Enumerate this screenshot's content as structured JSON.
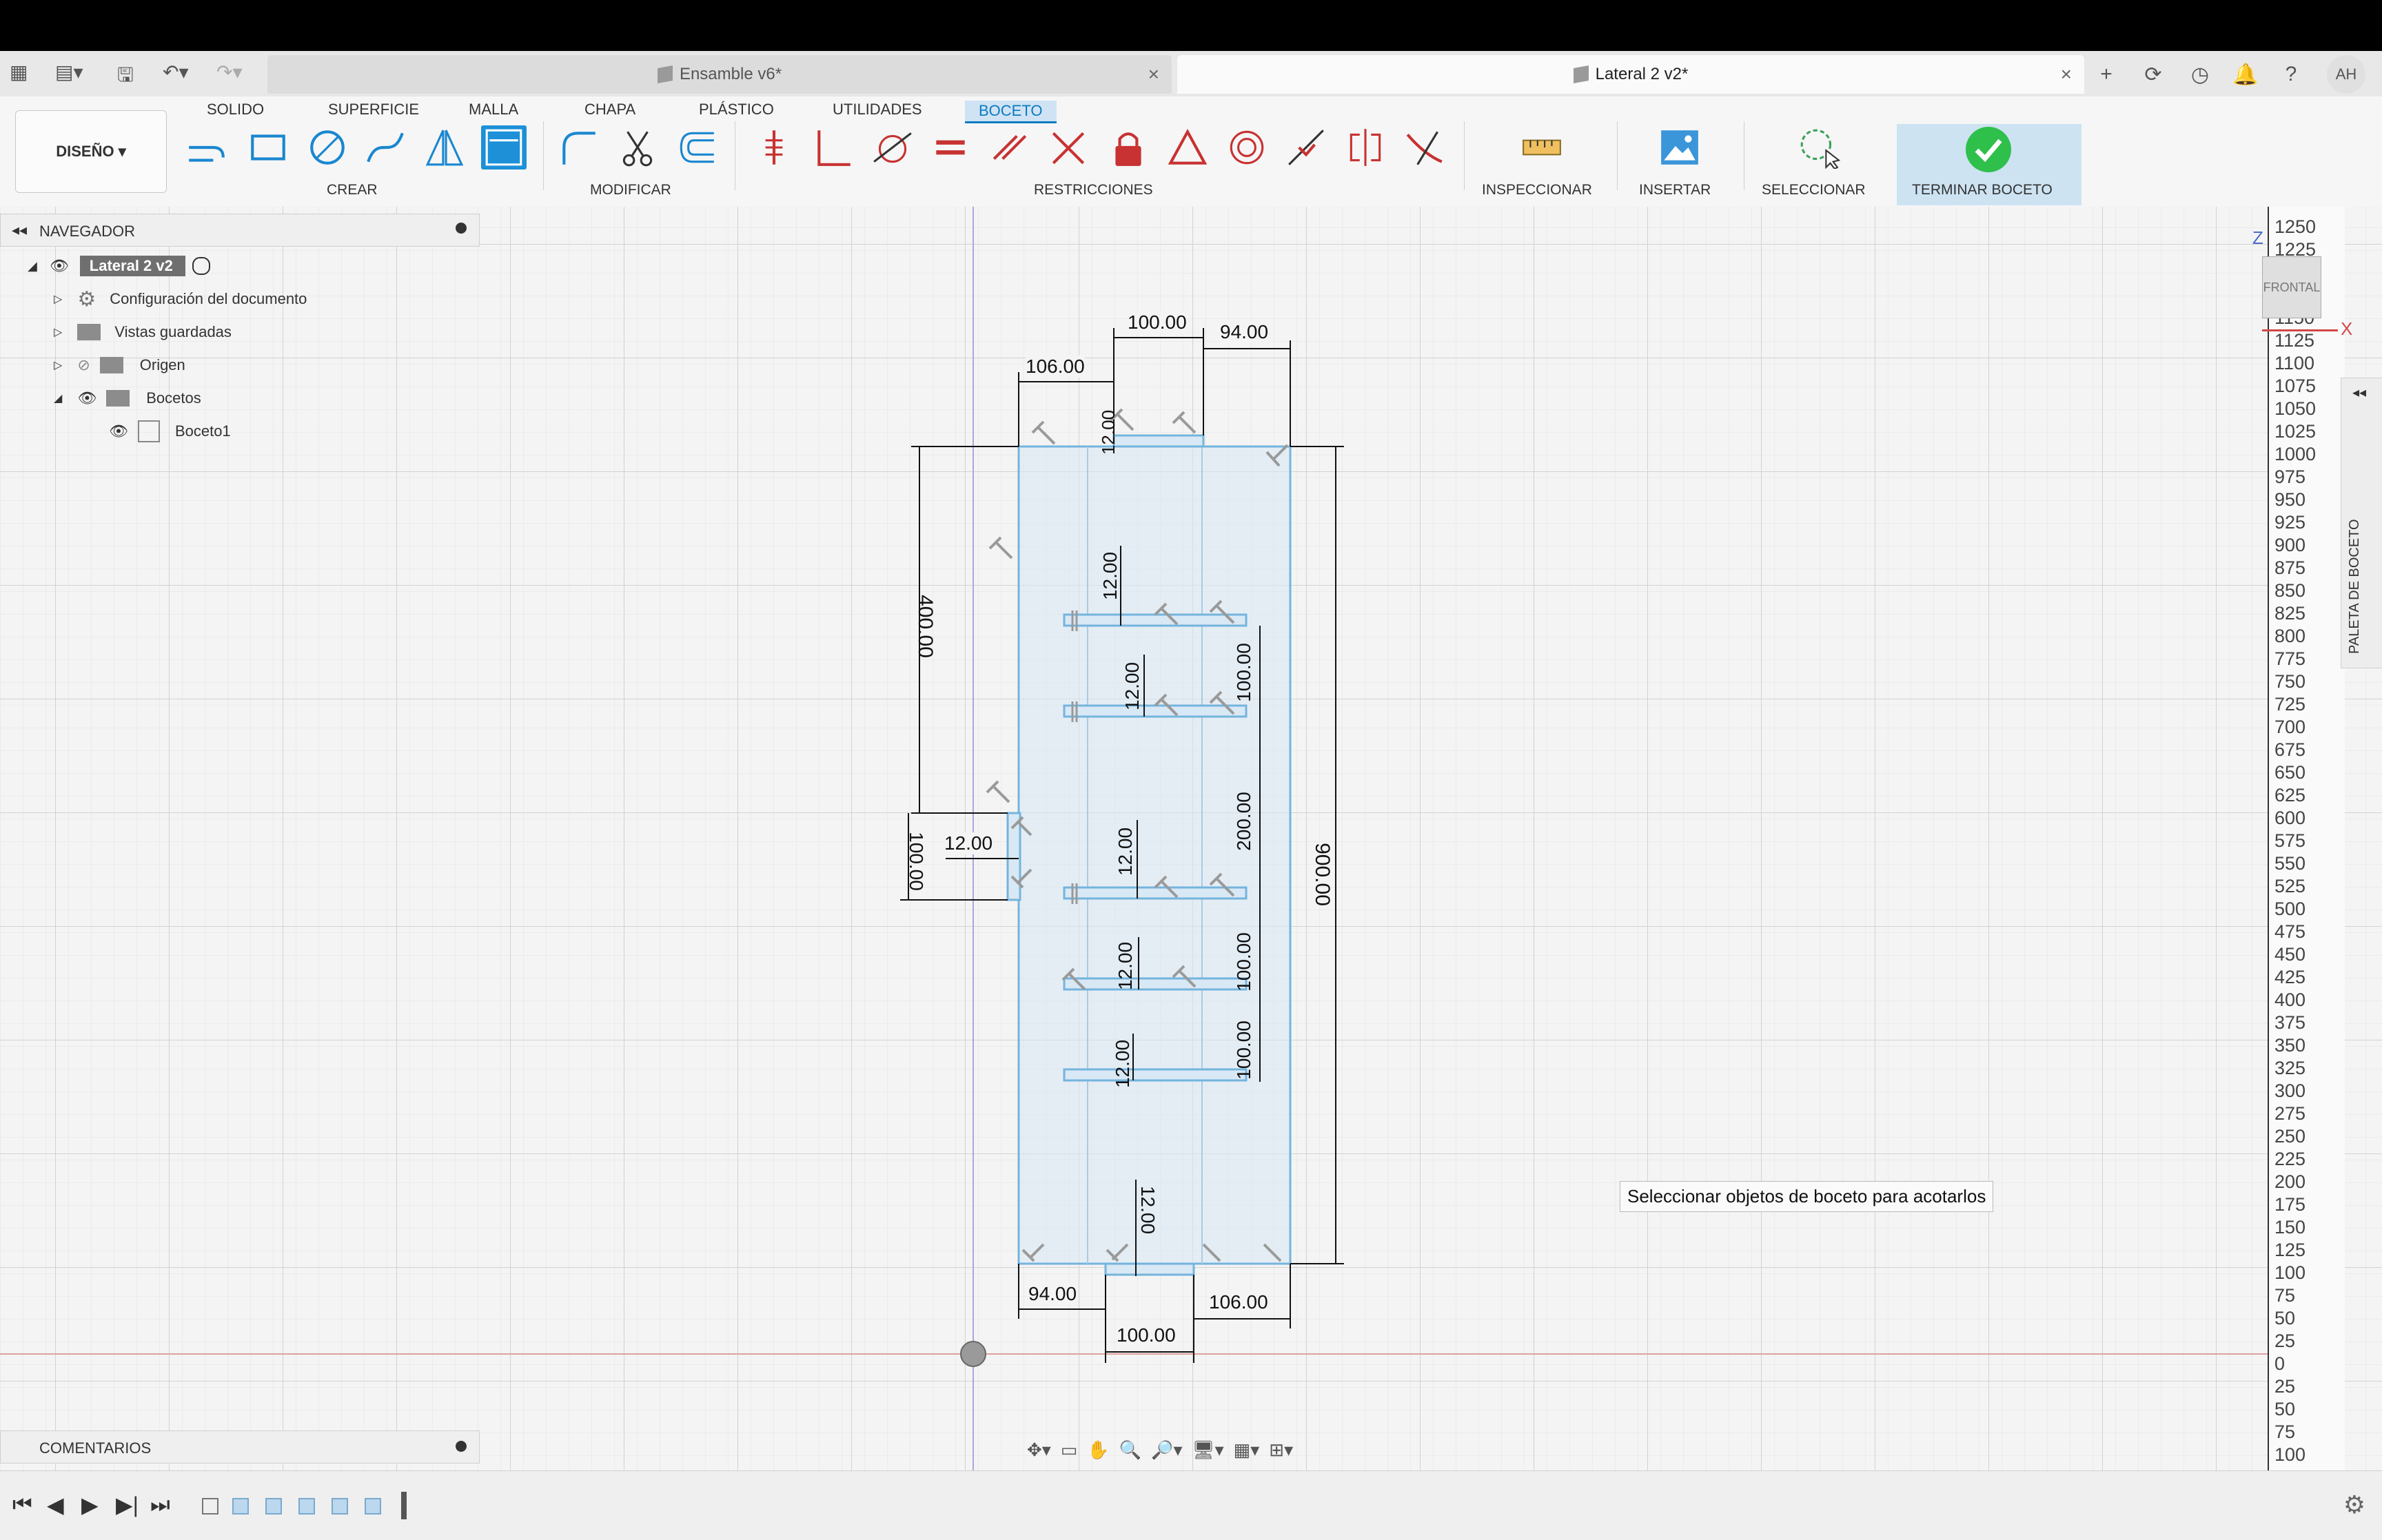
{
  "quick_access": {
    "grid_icon": "grid-icon",
    "file_icon": "file-icon",
    "save_icon": "save-icon",
    "undo_icon": "undo-icon",
    "redo_icon": "redo-icon"
  },
  "document_tabs": [
    {
      "label": "Ensamble v6*",
      "active": false
    },
    {
      "label": "Lateral 2 v2*",
      "active": true
    }
  ],
  "user": {
    "initials": "AH"
  },
  "workspace": {
    "label": "DISEÑO"
  },
  "menu_tabs": [
    "SOLIDO",
    "SUPERFICIE",
    "MALLA",
    "CHAPA",
    "PLÁSTICO",
    "UTILIDADES",
    "BOCETO"
  ],
  "active_menu_tab": "BOCETO",
  "toolbar_groups": {
    "create": "CREAR",
    "modify": "MODIFICAR",
    "constraints": "RESTRICCIONES",
    "inspect": "INSPECCIONAR",
    "insert": "INSERTAR",
    "select": "SELECCIONAR",
    "finish": "TERMINAR BOCETO"
  },
  "browser": {
    "title": "NAVEGADOR",
    "root": "Lateral 2 v2",
    "items": [
      {
        "label": "Configuración del documento",
        "icon": "gear-icon"
      },
      {
        "label": "Vistas guardadas",
        "icon": "folder-icon"
      },
      {
        "label": "Origen",
        "icon": "folder-icon"
      },
      {
        "label": "Bocetos",
        "icon": "folder-icon"
      },
      {
        "label": "Boceto1",
        "icon": "sketch-icon"
      }
    ]
  },
  "comments": {
    "title": "COMENTARIOS"
  },
  "sketch_palette": {
    "title": "PALETA DE BOCETO"
  },
  "navcube": {
    "face": "FRONTAL",
    "axis_z": "Z",
    "axis_x": "X"
  },
  "hint": {
    "text": "Seleccionar objetos de boceto para acotarlos"
  },
  "ruler_labels": [
    "1250",
    "1225",
    "1200",
    "1175",
    "1150",
    "1125",
    "1100",
    "1075",
    "1050",
    "1025",
    "1000",
    "975",
    "950",
    "925",
    "900",
    "875",
    "850",
    "825",
    "800",
    "775",
    "750",
    "725",
    "700",
    "675",
    "650",
    "625",
    "600",
    "575",
    "550",
    "525",
    "500",
    "475",
    "450",
    "425",
    "400",
    "375",
    "350",
    "325",
    "300",
    "275",
    "250",
    "225",
    "200",
    "175",
    "150",
    "125",
    "100",
    "75",
    "50",
    "25",
    "0",
    "25",
    "50",
    "75",
    "100",
    "125"
  ],
  "dimensions": {
    "top_100": "100.00",
    "top_94": "94.00",
    "top_106": "106.00",
    "d_12_a": "12.00",
    "d_12_b": "12.00",
    "d_12_c": "12.00",
    "d_12_d": "12.00",
    "d_12_e": "12.00",
    "d_12_f": "12.00",
    "d_12_g": "12.00",
    "d_12_h": "12.00",
    "left_400": "400.00",
    "left_100": "100.00",
    "right_100_a": "100.00",
    "right_200": "200.00",
    "right_100_b": "100.00",
    "right_100_c": "100.00",
    "total_900": "900.00",
    "bottom_94": "94.00",
    "bottom_100": "100.00",
    "bottom_106": "106.00"
  }
}
